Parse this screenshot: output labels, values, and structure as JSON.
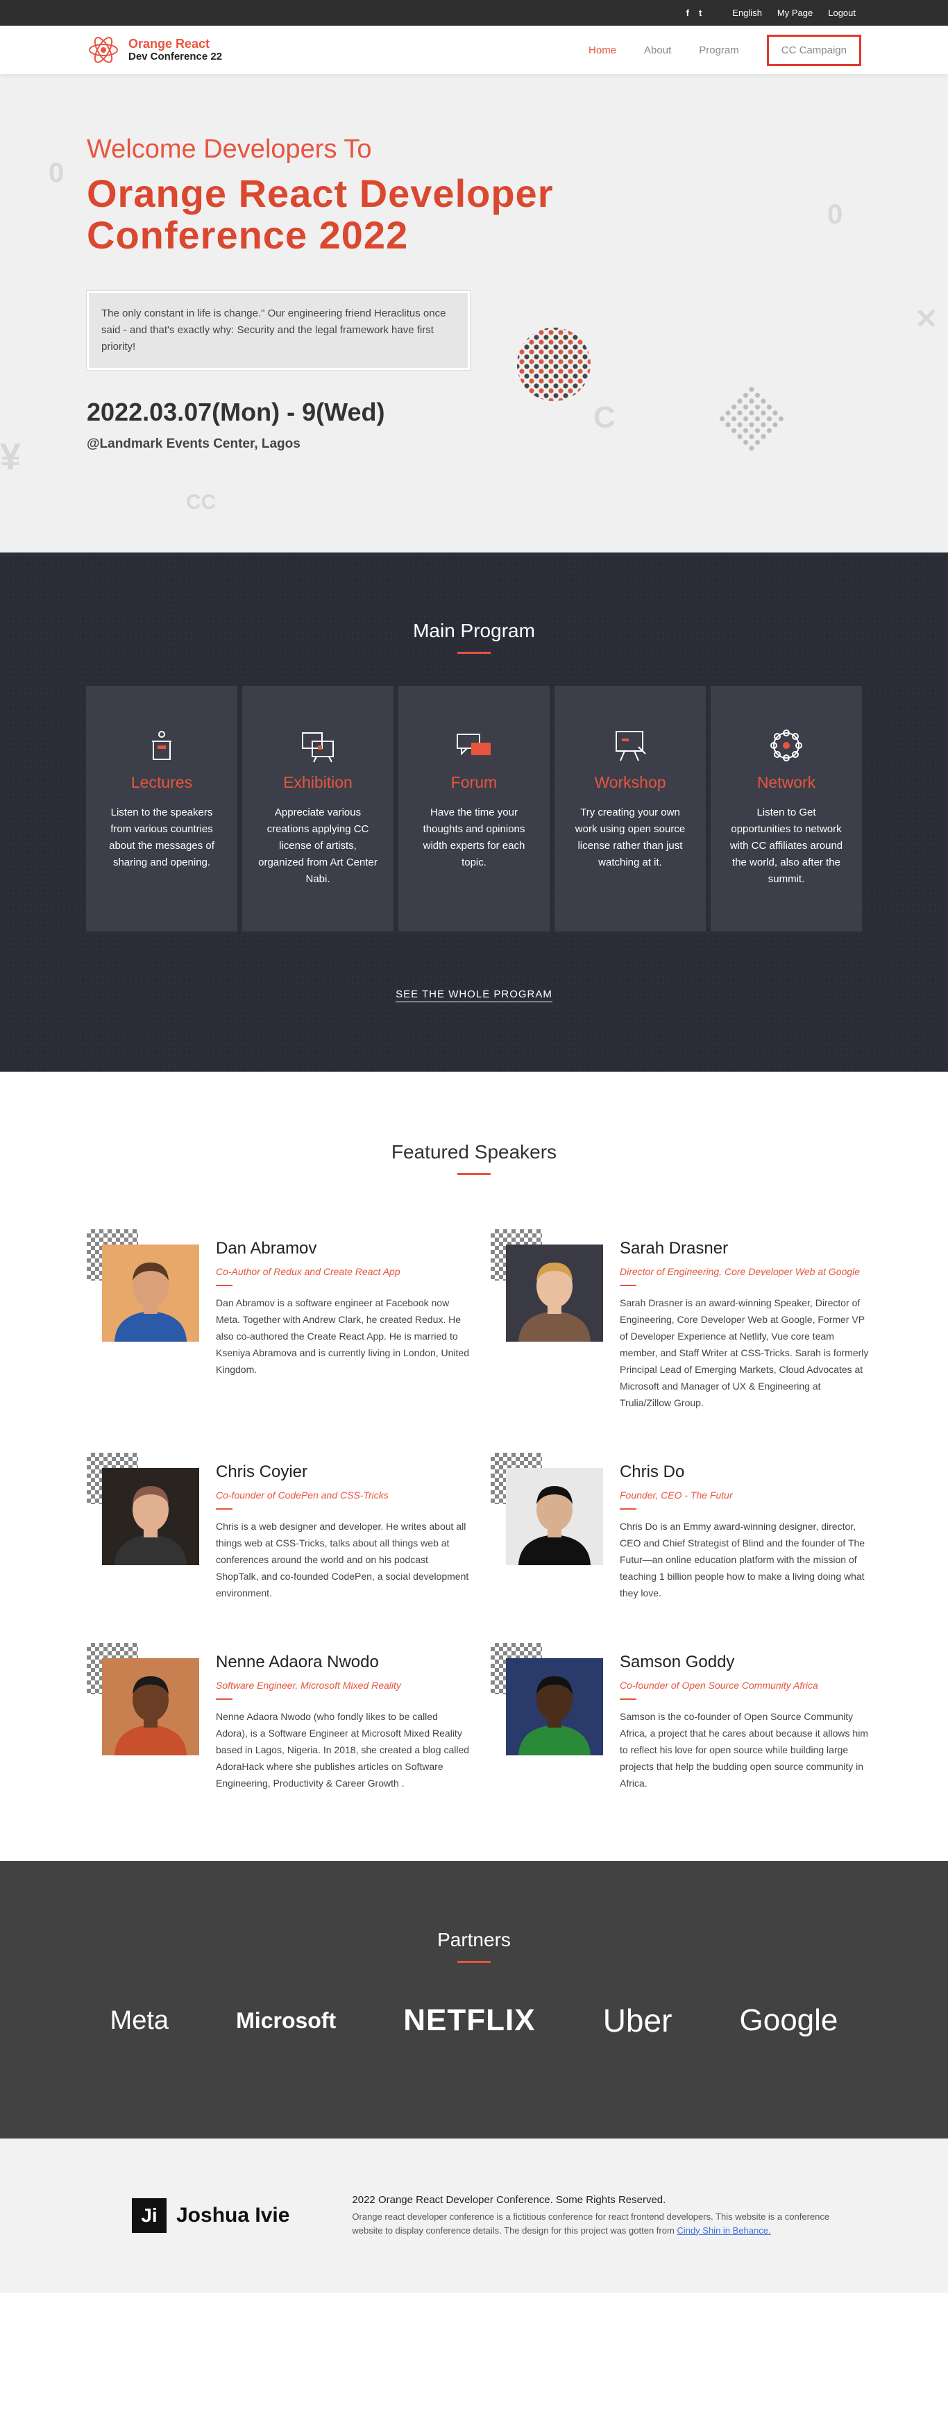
{
  "topbar": {
    "social": [
      "f",
      "t"
    ],
    "links": [
      "English",
      "My Page",
      "Logout"
    ]
  },
  "nav": {
    "brand_line1": "Orange React",
    "brand_line2": "Dev Conference 22",
    "items": [
      "Home",
      "About",
      "Program"
    ],
    "cta": "CC Campaign"
  },
  "hero": {
    "welcome": "Welcome Developers To",
    "title": "Orange React Developer Conference 2022",
    "quote": "The only constant in life is change.\" Our engineering friend Heraclitus once said - and that's exactly why: Security and the legal framework have first priority!",
    "date": "2022.03.07(Mon) - 9(Wed)",
    "venue": "@Landmark Events Center, Lagos"
  },
  "program": {
    "title": "Main Program",
    "cards": [
      {
        "icon": "lectern-icon",
        "title": "Lectures",
        "desc": "Listen to the speakers from various countries about the messages of sharing and opening."
      },
      {
        "icon": "easel-icon",
        "title": "Exhibition",
        "desc": "Appreciate various creations applying CC license of artists, organized from Art Center Nabi."
      },
      {
        "icon": "chat-icon",
        "title": "Forum",
        "desc": "Have the time your thoughts and opinions width experts for each topic."
      },
      {
        "icon": "whiteboard-icon",
        "title": "Workshop",
        "desc": "Try creating your own work using open source license rather than just watching at it."
      },
      {
        "icon": "network-icon",
        "title": "Network",
        "desc": "Listen to Get opportunities to network with CC affiliates around the world, also after the summit."
      }
    ],
    "see_all": "SEE THE WHOLE PROGRAM"
  },
  "speakers": {
    "title": "Featured Speakers",
    "items": [
      {
        "name": "Dan Abramov",
        "role": "Co-Author of Redux and Create React App",
        "bio": "Dan Abramov is a software engineer at Facebook now Meta. Together with Andrew Clark, he created Redux. He also co-authored the Create React App. He is married to Kseniya Abramova and is currently living in London, United Kingdom.",
        "bg": "#e8a86a",
        "shirt": "#2a5aa8",
        "skin": "#d9a07a",
        "hair": "#5a3a22"
      },
      {
        "name": "Sarah Drasner",
        "role": "Director of Engineering, Core Developer Web at Google",
        "bio": "Sarah Drasner is an award-winning Speaker, Director of Engineering, Core Developer Web at Google, Former VP of Developer Experience at Netlify, Vue core team member, and Staff Writer at CSS-Tricks. Sarah is formerly Principal Lead of Emerging Markets, Cloud Advocates at Microsoft and Manager of UX & Engineering at Trulia/Zillow Group.",
        "bg": "#3a3a44",
        "shirt": "#7a5a44",
        "skin": "#e8c0a0",
        "hair": "#d4a050"
      },
      {
        "name": "Chris Coyier",
        "role": "Co-founder of CodePen and CSS-Tricks",
        "bio": "Chris is a web designer and developer. He writes about all things web at CSS-Tricks, talks about all things web at conferences around the world and on his podcast ShopTalk, and co-founded CodePen, a social development environment.",
        "bg": "#2a2420",
        "shirt": "#333",
        "skin": "#e0b090",
        "hair": "#8a5a4a"
      },
      {
        "name": "Chris Do",
        "role": "Founder, CEO - The Futur",
        "bio": "Chris Do is an Emmy award-winning designer, director, CEO and Chief Strategist of Blind and the founder of The Futur—an online education platform with the mission of teaching 1 billion people how to make a living doing what they love.",
        "bg": "#e8e8e8",
        "shirt": "#111",
        "skin": "#d8b090",
        "hair": "#111"
      },
      {
        "name": "Nenne Adaora Nwodo",
        "role": "Software Engineer, Microsoft Mixed Reality",
        "bio": "Nenne Adaora Nwodo (who fondly likes to be called Adora), is a Software Engineer at Microsoft Mixed Reality based in Lagos, Nigeria. In 2018, she created a blog called AdoraHack where she publishes articles on Software Engineering, Productivity & Career Growth .",
        "bg": "#c88050",
        "shirt": "#c8502a",
        "skin": "#6a3e24",
        "hair": "#1a1a1a"
      },
      {
        "name": "Samson Goddy",
        "role": "Co-founder of Open Source Community Africa",
        "bio": "Samson is the co-founder of Open Source Community Africa, a project that he cares about because it allows him to reflect his love for open source while building large projects that help the budding open source community in Africa.",
        "bg": "#2a3a6a",
        "shirt": "#2a8a3a",
        "skin": "#4a2e1c",
        "hair": "#111"
      }
    ]
  },
  "partners": {
    "title": "Partners",
    "logos": [
      "Meta",
      "Microsoft",
      "NETFLIX",
      "Uber",
      "Google"
    ]
  },
  "footer": {
    "logo_mark": "Ji",
    "logo_name": "Joshua Ivie",
    "copyright": "2022 Orange React Developer Conference. Some Rights Reserved.",
    "desc": "Orange react developer conference is a fictitious conference for react frontend developers. This website is a conference website to display conference details. The design for this project was gotten from",
    "link": "Cindy Shin in Behance."
  },
  "colors": {
    "accent": "#e8553e",
    "dark": "#2a2d37",
    "partners_bg": "#424242"
  }
}
